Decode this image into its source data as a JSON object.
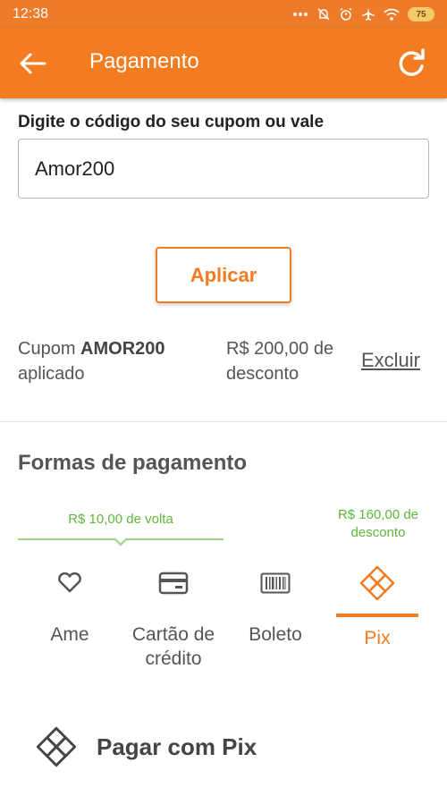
{
  "status_bar": {
    "time": "12:38",
    "battery": "75",
    "icons": [
      "dots-icon",
      "alarm-off-icon",
      "alarm-icon",
      "airplane-icon",
      "wifi-icon",
      "battery-icon"
    ]
  },
  "app_bar": {
    "title": "Pagamento",
    "icons": [
      "back-arrow-icon",
      "refresh-icon"
    ]
  },
  "coupon": {
    "label": "Digite o código do seu cupom ou vale",
    "input_value": "Amor200",
    "apply_label": "Aplicar",
    "applied_prefix": "Cupom",
    "applied_code": "AMOR200",
    "applied_suffix": "aplicado",
    "discount_text": "R$ 200,00 de desconto",
    "remove_label": "Excluir"
  },
  "payment": {
    "section_title": "Formas de pagamento",
    "cashback_note": "R$ 10,00 de volta",
    "discount_note": "R$ 160,00 de desconto",
    "methods": [
      {
        "label": "Ame",
        "icon": "heart-icon",
        "selected": false
      },
      {
        "label": "Cartão de crédito",
        "icon": "credit-card-icon",
        "selected": false
      },
      {
        "label": "Boleto",
        "icon": "barcode-icon",
        "selected": false
      },
      {
        "label": "Pix",
        "icon": "pix-icon",
        "selected": true
      }
    ],
    "pix_pay_label": "Pagar com Pix"
  },
  "colors": {
    "brand_orange": "#f37b20",
    "status_orange": "#ee7b2a",
    "success_green": "#5db83b"
  }
}
